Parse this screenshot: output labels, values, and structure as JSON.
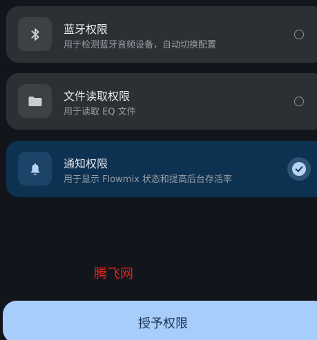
{
  "permissions": [
    {
      "title": "蓝牙权限",
      "description": "用于检测蓝牙音频设备，自动切换配置",
      "icon": "bluetooth-icon",
      "selected": false
    },
    {
      "title": "文件读取权限",
      "description": "用于读取 EQ 文件",
      "icon": "folder-icon",
      "selected": false
    },
    {
      "title": "通知权限",
      "description": "用于显示 Flowmix 状态和提高后台存活率",
      "icon": "bell-icon",
      "selected": true
    }
  ],
  "watermark": "腾飞网",
  "grant_button_label": "授予权限",
  "colors": {
    "background": "#12161c",
    "card": "#2c3034",
    "card_selected": "#0d3150",
    "accent": "#a7cdfb"
  }
}
